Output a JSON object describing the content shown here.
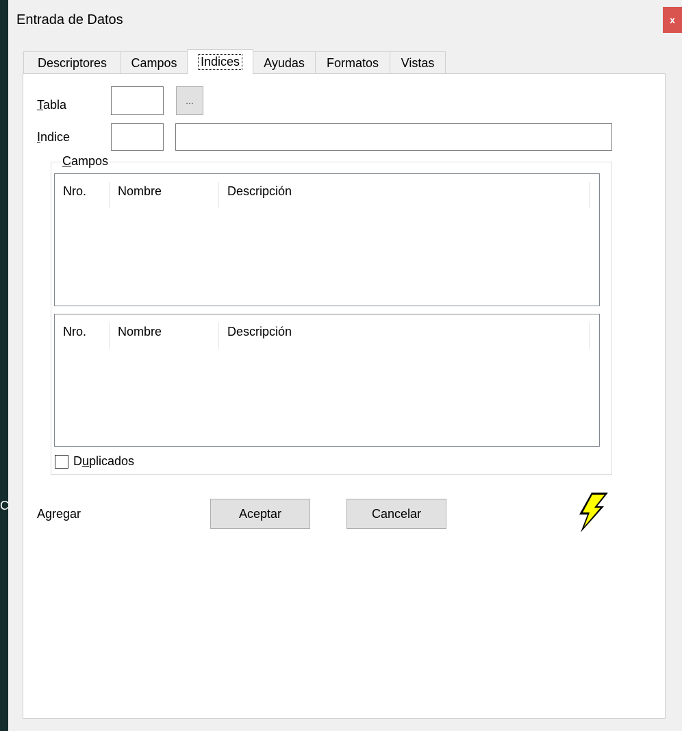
{
  "window": {
    "title": "Entrada de Datos",
    "close_label": "x"
  },
  "tabs": [
    {
      "label": "Descriptores",
      "active": false
    },
    {
      "label": "Campos",
      "active": false
    },
    {
      "label": "Indices",
      "active": true
    },
    {
      "label": "Ayudas",
      "active": false
    },
    {
      "label": "Formatos",
      "active": false
    },
    {
      "label": "Vistas",
      "active": false
    }
  ],
  "form": {
    "tabla": {
      "label_mnemonic": "T",
      "label_rest": "abla",
      "value": ""
    },
    "browse_label": "...",
    "indice": {
      "label_mnemonic": "I",
      "label_rest": "ndice",
      "code_value": "",
      "description_value": ""
    }
  },
  "campos_group": {
    "legend_mnemonic": "C",
    "legend_rest": "ampos",
    "list_top": {
      "columns": [
        "Nro.",
        "Nombre",
        "Descripción"
      ],
      "rows": []
    },
    "list_bottom": {
      "columns": [
        "Nro.",
        "Nombre",
        "Descripción"
      ],
      "rows": []
    },
    "duplicados": {
      "label_pre": "D",
      "label_mnemonic": "u",
      "label_rest": "plicados",
      "checked": false
    }
  },
  "footer": {
    "mode_label": "Agregar",
    "accept_label": "Aceptar",
    "cancel_label": "Cancelar",
    "icon": "lightning-bolt-icon"
  },
  "background_glyph": "C",
  "colors": {
    "desktop": "#142c2c",
    "close_button": "#d9534f",
    "bolt_fill": "#ffff00"
  }
}
